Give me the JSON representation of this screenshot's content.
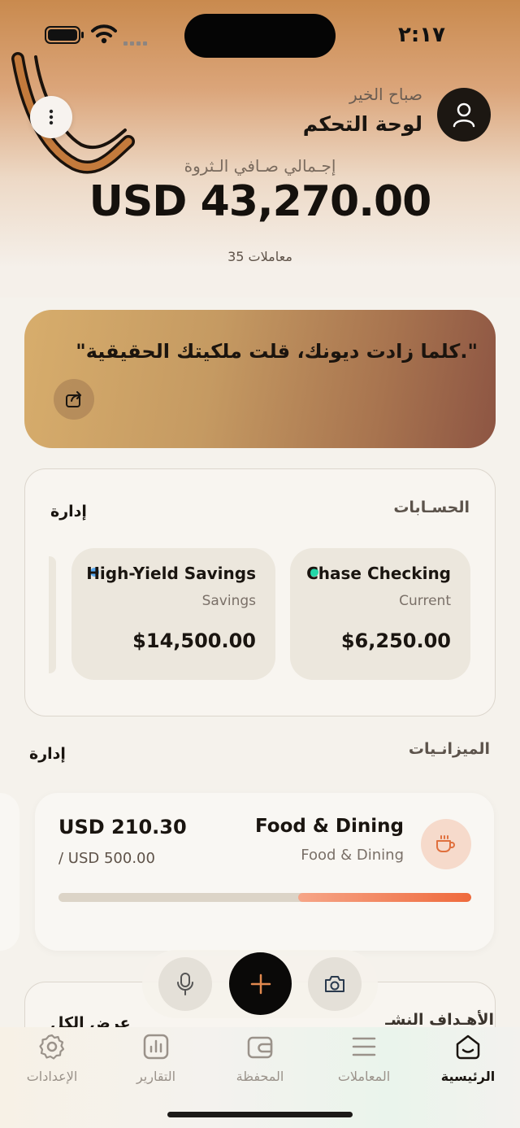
{
  "status_bar": {
    "time": "٢:١٧"
  },
  "header": {
    "greeting": "صباح الخير",
    "title": "لوحة التحكم",
    "net_worth_label": "إجـمالي صـافي الـثروة",
    "net_worth_value": "USD 43,270.00",
    "transactions_count": "35 معاملات"
  },
  "quote": {
    "text": "\"كلما زادت ديونك، قلت ملكيتك الحقيقية.\""
  },
  "accounts": {
    "title": "الحسـابات",
    "action": "إدارة",
    "items": [
      {
        "name": "Chase Checking",
        "type": "Current",
        "balance": "$6,250.00",
        "dot_color": "#22d8a8"
      },
      {
        "name": "High-Yield Savings",
        "type": "Savings",
        "balance": "$14,500.00",
        "dot_color": "#5aa9f0"
      }
    ]
  },
  "budgets": {
    "title": "الميزانـيات",
    "action": "إدارة",
    "items": [
      {
        "name": "Food & Dining",
        "category": "Food & Dining",
        "spent": "USD 210.30",
        "limit": "/ USD 500.00",
        "progress": 0.42,
        "icon": "coffee-icon"
      }
    ]
  },
  "goals": {
    "title": "الأهـداف النشـ",
    "action": "عرض الكل"
  },
  "fab": {
    "main_icon": "plus-icon",
    "left_icon": "camera-icon",
    "right_icon": "microphone-icon"
  },
  "tabs": [
    {
      "label": "الرئيسية",
      "icon": "home-icon",
      "active": true
    },
    {
      "label": "المعاملات",
      "icon": "list-icon",
      "active": false
    },
    {
      "label": "المحفظة",
      "icon": "wallet-icon",
      "active": false
    },
    {
      "label": "التقارير",
      "icon": "chart-icon",
      "active": false
    },
    {
      "label": "الإعدادات",
      "icon": "gear-icon",
      "active": false
    }
  ],
  "colors": {
    "accent": "#ef6a3c",
    "dark": "#1a1510",
    "background": "#f5f2ec"
  }
}
